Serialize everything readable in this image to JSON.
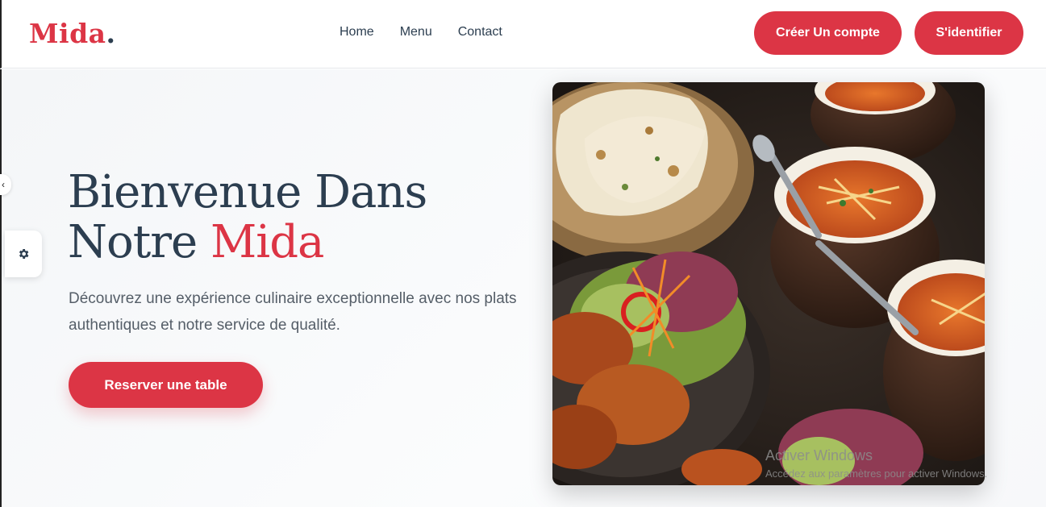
{
  "brand": {
    "name": "Mida",
    "dot": "."
  },
  "nav": {
    "items": [
      {
        "label": "Home"
      },
      {
        "label": "Menu"
      },
      {
        "label": "Contact"
      }
    ]
  },
  "header": {
    "register_label": "Créer Un compte",
    "login_label": "S'identifier"
  },
  "hero": {
    "title_line1": "Bienvenue Dans",
    "title_line2_prefix": "Notre",
    "title_accent": "Mida",
    "description": "Découvrez une expérience culinaire exceptionnelle avec nos plats authentiques et notre service de qualité.",
    "cta_label": "Reserver une table"
  },
  "side_panel": {
    "icon": "gear-icon",
    "handle_icon": "chevron-left-icon"
  },
  "watermark": {
    "title": "Activer Windows",
    "subtitle": "Accédez aux paramètres pour activer Windows."
  },
  "colors": {
    "accent": "#dc3545",
    "text_dark": "#2c3e50",
    "text_muted": "#555e68"
  }
}
